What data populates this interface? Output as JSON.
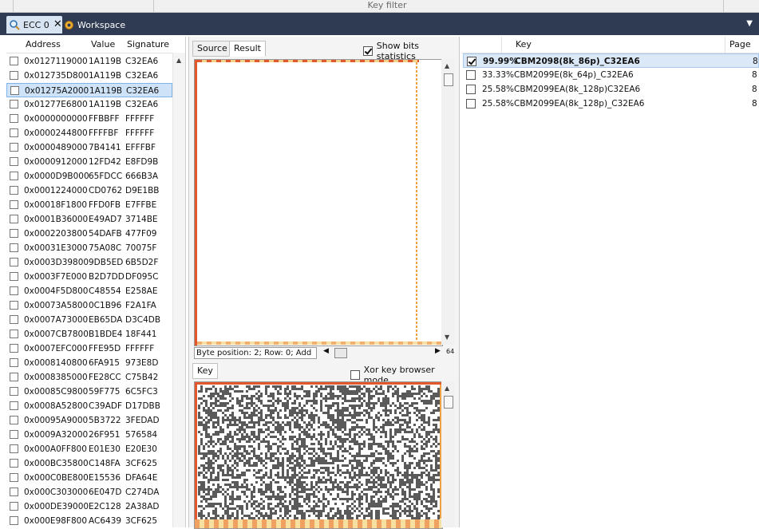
{
  "filter": {
    "label": "Key filter"
  },
  "tabs": {
    "ecc": {
      "label": "ECC 0",
      "close": "✕"
    },
    "workspace": {
      "label": "Workspace"
    },
    "menu_arrow": "▼"
  },
  "left_table": {
    "headers": {
      "address": "Address",
      "value": "Value",
      "signature": "Signature"
    },
    "rows": [
      {
        "address": "0x0127119000",
        "value": "1A119B",
        "signature": "C32EA6"
      },
      {
        "address": "0x012735D800",
        "value": "1A119B",
        "signature": "C32EA6"
      },
      {
        "address": "0x01275A2000",
        "value": "1A119B",
        "signature": "C32EA6",
        "selected": true
      },
      {
        "address": "0x01277E6800",
        "value": "1A119B",
        "signature": "C32EA6"
      },
      {
        "address": "0x0000000000",
        "value": "FFBBFF",
        "signature": "FFFFFF"
      },
      {
        "address": "0x0000244800",
        "value": "FFFFBF",
        "signature": "FFFFFF"
      },
      {
        "address": "0x0000489000",
        "value": "7B4141",
        "signature": "EFFFBF"
      },
      {
        "address": "0x0000912000",
        "value": "12FD42",
        "signature": "E8FD9B"
      },
      {
        "address": "0x0000D9B000",
        "value": "65FDCC",
        "signature": "666B3A"
      },
      {
        "address": "0x0001224000",
        "value": "CD0762",
        "signature": "D9E1BB"
      },
      {
        "address": "0x00018F1800",
        "value": "FFD0FB",
        "signature": "E7FFBE"
      },
      {
        "address": "0x0001B36000",
        "value": "E49AD7",
        "signature": "3714BE"
      },
      {
        "address": "0x0002203800",
        "value": "54DAFB",
        "signature": "477F09"
      },
      {
        "address": "0x00031E3000",
        "value": "75A08C",
        "signature": "70075F"
      },
      {
        "address": "0x0003D39800",
        "value": "9DB5ED",
        "signature": "6B5D2F"
      },
      {
        "address": "0x0003F7E000",
        "value": "B2D7DD",
        "signature": "DF095C"
      },
      {
        "address": "0x0004F5D800",
        "value": "C48554",
        "signature": "E258AE"
      },
      {
        "address": "0x00073A5800",
        "value": "0C1B96",
        "signature": "F2A1FA"
      },
      {
        "address": "0x0007A73000",
        "value": "EB65DA",
        "signature": "D3C4DB"
      },
      {
        "address": "0x0007CB7800",
        "value": "B1BDE4",
        "signature": "18F441"
      },
      {
        "address": "0x0007EFC000",
        "value": "FFE95D",
        "signature": "FFFFFF"
      },
      {
        "address": "0x0008140800",
        "value": "6FA915",
        "signature": "973E8D"
      },
      {
        "address": "0x0008385000",
        "value": "FE28CC",
        "signature": "C75B42"
      },
      {
        "address": "0x00085C9800",
        "value": "59F775",
        "signature": "6C5FC3"
      },
      {
        "address": "0x0008A52800",
        "value": "C39ADF",
        "signature": "D17DBB"
      },
      {
        "address": "0x00095A9000",
        "value": "5B3722",
        "signature": "3FEDAD"
      },
      {
        "address": "0x0009A32000",
        "value": "26F951",
        "signature": "576584"
      },
      {
        "address": "0x000A0FF800",
        "value": "E01E30",
        "signature": "E20E30"
      },
      {
        "address": "0x000BC35800",
        "value": "C148FA",
        "signature": "3CF625"
      },
      {
        "address": "0x000C0BE800",
        "value": "E15536",
        "signature": "DFA64E"
      },
      {
        "address": "0x000C303000",
        "value": "6E047D",
        "signature": "C274DA"
      },
      {
        "address": "0x000DE39000",
        "value": "E2C128",
        "signature": "2A38AD"
      },
      {
        "address": "0x000E98F800",
        "value": "AC6439",
        "signature": "3CF625"
      }
    ]
  },
  "middle": {
    "tab_source": "Source",
    "tab_result": "Result",
    "show_bits": {
      "label": "Show bits statistics",
      "checked": true
    },
    "byte_position": "Byte position: 2; Row: 0; Add",
    "hscroll_count": "64",
    "key_tab": "Key",
    "xor_mode": {
      "label": "Xor key browser mode",
      "checked": false
    }
  },
  "right_table": {
    "headers": {
      "key": "Key",
      "page": "Page"
    },
    "rows": [
      {
        "percent": "99.99%",
        "key": "CBM2098(8k_86p)_C32EA6",
        "checked": true,
        "selected": true,
        "page": "8"
      },
      {
        "percent": "33.33%",
        "key": "CBM2099E(8k_64p)_C32EA6",
        "checked": false,
        "page": "8"
      },
      {
        "percent": "25.58%",
        "key": "CBM2099EA(8k_128p)C32EA6",
        "checked": false,
        "page": "8"
      },
      {
        "percent": "25.58%",
        "key": "CBM2099EA(8k_128p)_C32EA6",
        "checked": false,
        "page": "8"
      }
    ]
  },
  "colors": {
    "tabstrip": "#2e3b52",
    "selection": "#cfe3f8",
    "edge_red": "#e2572b",
    "edge_orange": "#f0a040"
  },
  "icons": [
    "search-icon",
    "close-icon",
    "gear-icon",
    "menu-arrow-icon",
    "checkbox-icon",
    "scroll-up-icon",
    "scroll-down-icon",
    "scroll-left-icon",
    "scroll-right-icon"
  ]
}
